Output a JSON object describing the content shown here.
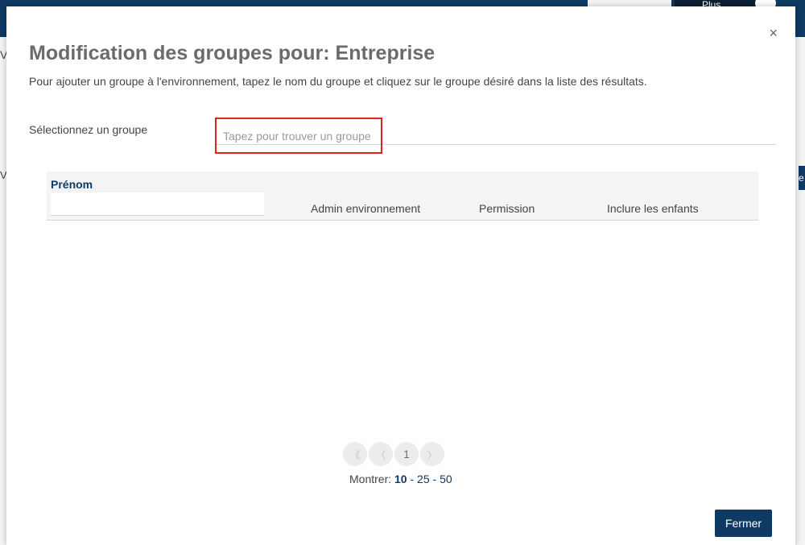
{
  "background": {
    "plus_label": "Plus",
    "left_edge_text": "V",
    "left_edge_text2": "V",
    "right_edge_text": "e"
  },
  "modal": {
    "close_label": "×",
    "title": "Modification des groupes pour: Entreprise",
    "description": "Pour ajouter un groupe à l'environnement, tapez le nom du groupe et cliquez sur le groupe désiré dans la liste des résultats.",
    "group_field": {
      "label": "Sélectionnez un groupe",
      "placeholder": "Tapez pour trouver un groupe",
      "value": ""
    },
    "table": {
      "columns": {
        "first_name": "Prénom",
        "env_admin": "Admin environnement",
        "permission": "Permission",
        "include_children": "Inclure les enfants"
      },
      "first_name_filter_value": "",
      "rows": []
    },
    "pagination": {
      "first_icon": "《",
      "prev_icon": "〈",
      "current_page": "1",
      "next_icon": "〉",
      "show_label": "Montrer:",
      "page_sizes": [
        "10",
        "25",
        "50"
      ],
      "page_size_separator": " - ",
      "selected_page_size": "10"
    },
    "close_button_label": "Fermer"
  },
  "colors": {
    "brand_navy": "#0e3a64",
    "highlight_red": "#e2231a"
  }
}
